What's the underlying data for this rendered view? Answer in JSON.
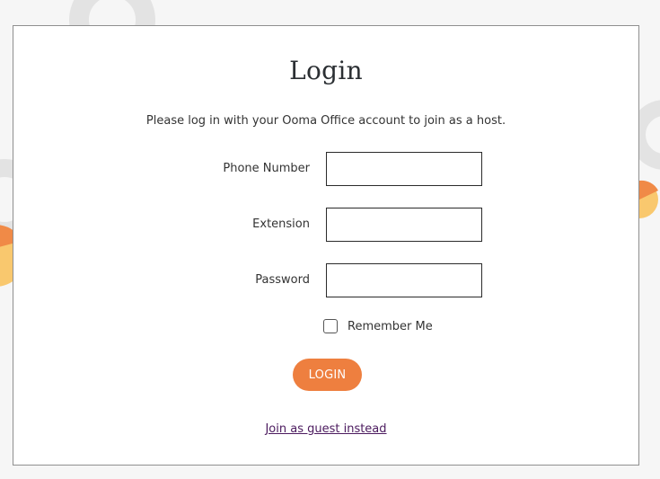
{
  "login": {
    "title": "Login",
    "subtitle": "Please log in with your Ooma Office account to join as a host.",
    "fields": [
      {
        "label": "Phone Number",
        "value": ""
      },
      {
        "label": "Extension",
        "value": ""
      },
      {
        "label": "Password",
        "value": ""
      }
    ],
    "remember_label": "Remember Me",
    "remember_checked": false,
    "login_button_label": "LOGIN",
    "guest_link_text": "Join as guest instead"
  },
  "colors": {
    "accent": "#ee7f3f",
    "link": "#4b1a5e",
    "deco_gray": "#e3e3e3",
    "deco_orange": "#f08a47",
    "deco_yellow": "#f9c86e"
  }
}
